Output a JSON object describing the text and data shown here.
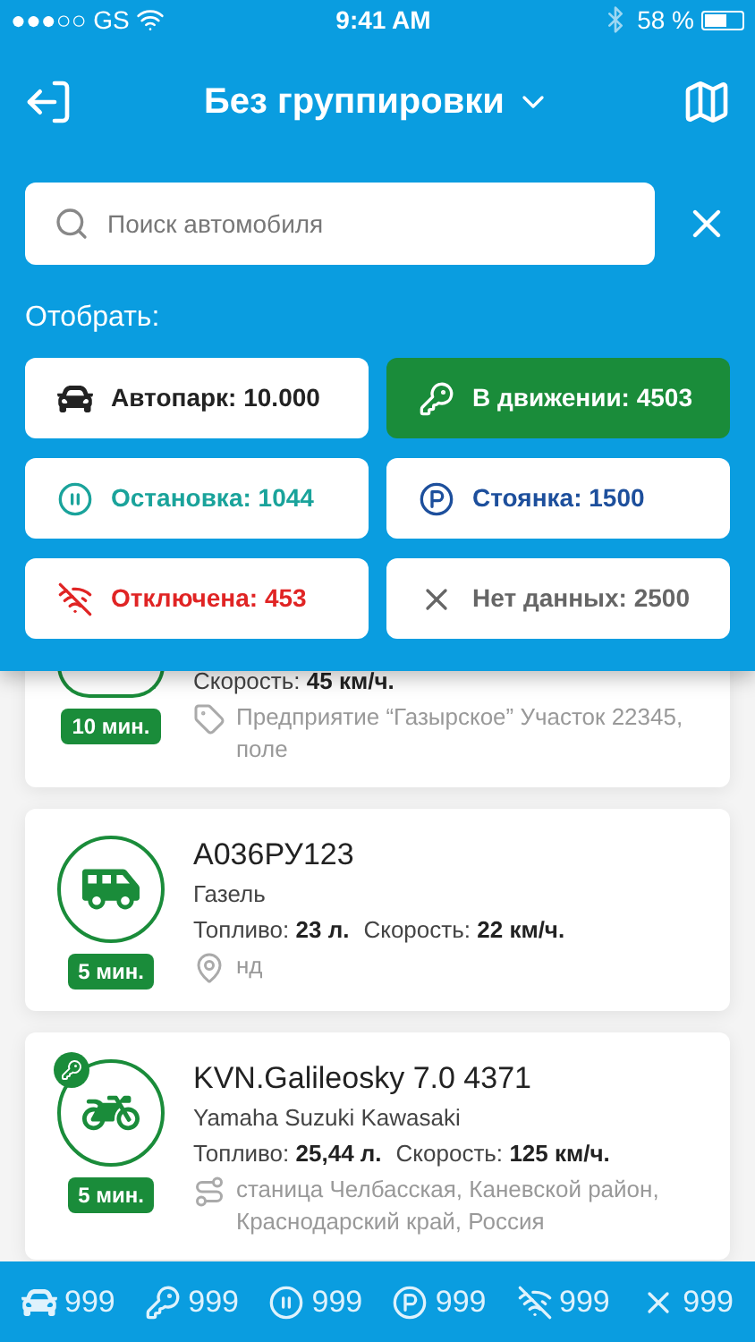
{
  "status_bar": {
    "carrier": "●●●○○ GS",
    "time": "9:41 AM",
    "battery_text": "58 %"
  },
  "header": {
    "title": "Без группировки"
  },
  "search": {
    "placeholder": "Поиск автомобиля"
  },
  "filter_label": "Отобрать:",
  "filters": [
    {
      "kind": "car",
      "label": "Автопарк: 10.000",
      "selected": false,
      "color": "#222222"
    },
    {
      "kind": "key",
      "label": "В движении: 4503",
      "selected": true,
      "color": "#1a8c3a"
    },
    {
      "kind": "pause",
      "label": "Остановка: 1044",
      "selected": false,
      "color": "#1aa39b"
    },
    {
      "kind": "parking",
      "label": "Стоянка: 1500",
      "selected": false,
      "color": "#1d4f9c"
    },
    {
      "kind": "offline",
      "label": "Отключена: 453",
      "selected": false,
      "color": "#e02424"
    },
    {
      "kind": "nodata",
      "label": "Нет данных: 2500",
      "selected": false,
      "color": "#666666"
    }
  ],
  "vehicles": [
    {
      "moving": false,
      "time": "10 мин.",
      "stats": [
        {
          "label": "Скорость:",
          "value": "45 км/ч."
        }
      ],
      "location": {
        "kind": "tag",
        "text": "Предприятие “Газырское” Участок 22345, поле"
      }
    },
    {
      "kind": "bus",
      "moving": false,
      "name": "А036РУ123",
      "model": "Газель",
      "time": "5 мин.",
      "stats": [
        {
          "label": "Топливо:",
          "value": "23 л."
        },
        {
          "label": "Скорость:",
          "value": "22 км/ч."
        }
      ],
      "location": {
        "kind": "pin",
        "text": "нд"
      }
    },
    {
      "kind": "moto",
      "moving": true,
      "name": "KVN.Galileosky 7.0 4371",
      "model": "Yamaha Suzuki Kawasaki",
      "time": "5 мин.",
      "stats": [
        {
          "label": "Топливо:",
          "value": "25,44 л."
        },
        {
          "label": "Скорость:",
          "value": "125 км/ч."
        }
      ],
      "location": {
        "kind": "route",
        "text": "станица Челбасская, Каневской район, Краснодарский край, Россия"
      }
    }
  ],
  "bottom_bar": [
    {
      "kind": "car",
      "count": "999"
    },
    {
      "kind": "key",
      "count": "999"
    },
    {
      "kind": "pause",
      "count": "999"
    },
    {
      "kind": "parking",
      "count": "999"
    },
    {
      "kind": "offline",
      "count": "999"
    },
    {
      "kind": "nodata",
      "count": "999"
    }
  ]
}
